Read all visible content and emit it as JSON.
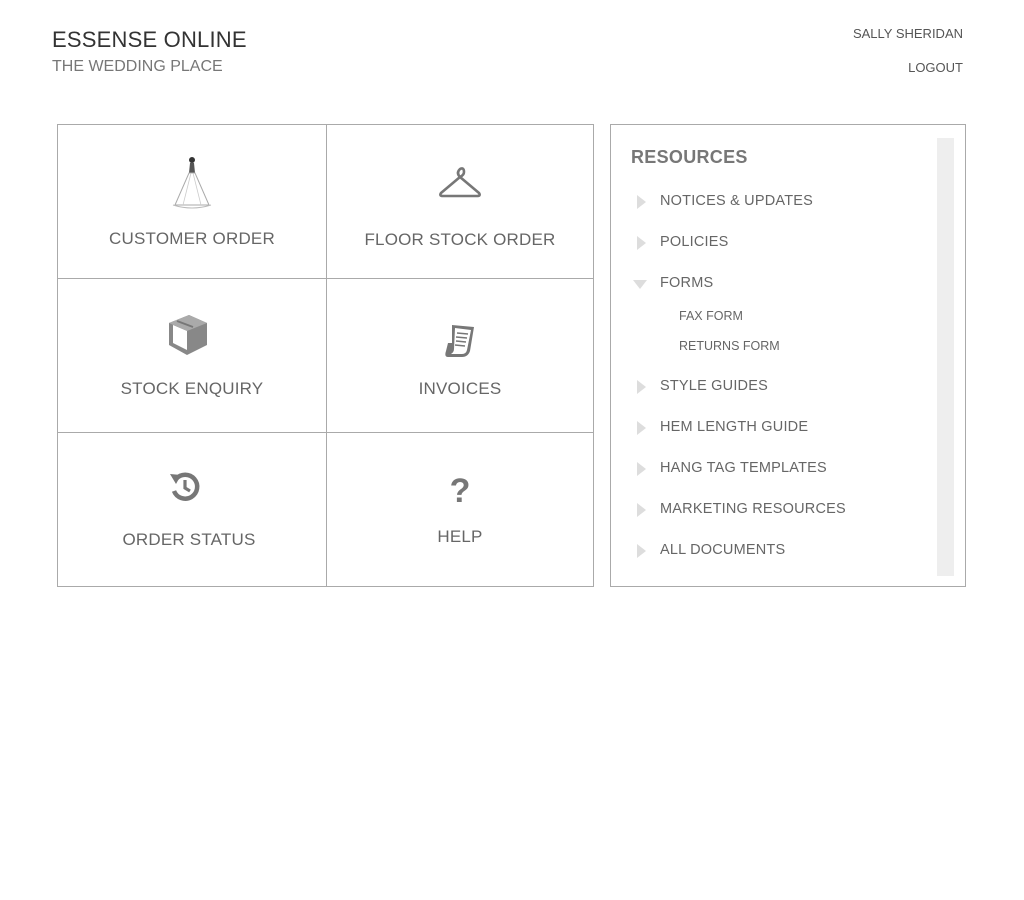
{
  "header": {
    "brand_title": "ESSENSE ONLINE",
    "brand_subtitle": "THE WEDDING PLACE",
    "user_name": "SALLY SHERIDAN",
    "logout_label": "LOGOUT"
  },
  "tiles": {
    "customer_order": {
      "label": "CUSTOMER ORDER",
      "icon": "bride-icon"
    },
    "floor_stock_order": {
      "label": "FLOOR STOCK ORDER",
      "icon": "hanger-icon"
    },
    "stock_enquiry": {
      "label": "STOCK ENQUIRY",
      "icon": "box-icon"
    },
    "invoices": {
      "label": "INVOICES",
      "icon": "invoice-icon"
    },
    "order_status": {
      "label": "ORDER STATUS",
      "icon": "history-icon"
    },
    "help": {
      "label": "HELP",
      "icon": "question-icon"
    }
  },
  "resources": {
    "title": "RESOURCES",
    "items": [
      {
        "label": "NOTICES & UPDATES",
        "expanded": false
      },
      {
        "label": "POLICIES",
        "expanded": false
      },
      {
        "label": "FORMS",
        "expanded": true,
        "children": [
          "FAX FORM",
          "RETURNS FORM"
        ]
      },
      {
        "label": "STYLE GUIDES",
        "expanded": false
      },
      {
        "label": "HEM LENGTH GUIDE",
        "expanded": false
      },
      {
        "label": "HANG TAG TEMPLATES",
        "expanded": false
      },
      {
        "label": "MARKETING RESOURCES",
        "expanded": false
      },
      {
        "label": "ALL DOCUMENTS",
        "expanded": false
      }
    ]
  },
  "colors": {
    "text": "#666666",
    "border": "#aaaaaa",
    "icon": "#777777",
    "arrow": "#dddddd"
  }
}
